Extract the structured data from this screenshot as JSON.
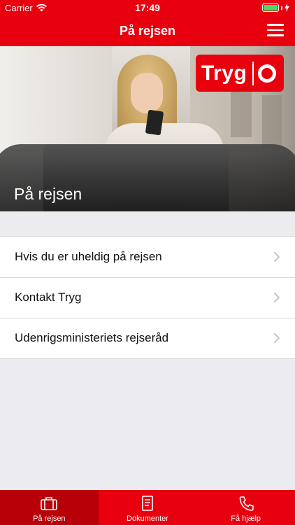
{
  "status_bar": {
    "carrier": "Carrier",
    "time": "17:49",
    "icons": [
      "wifi-icon",
      "battery-icon",
      "charging-icon"
    ],
    "battery_level": 1.0
  },
  "nav_bar": {
    "title": "På rejsen",
    "menu_icon": "hamburger-menu-icon"
  },
  "hero": {
    "caption": "På rejsen",
    "logo_text": "Tryg",
    "logo_icon": "lifebuoy-icon"
  },
  "menu_list": {
    "items": [
      {
        "label": "Hvis du er uheldig på rejsen",
        "icon": "chevron-right-icon"
      },
      {
        "label": "Kontakt Tryg",
        "icon": "chevron-right-icon"
      },
      {
        "label": "Udenrigsministeriets rejseråd",
        "icon": "chevron-right-icon"
      }
    ]
  },
  "tab_bar": {
    "tabs": [
      {
        "label": "På rejsen",
        "icon": "suitcase-icon",
        "active": true
      },
      {
        "label": "Dokumenter",
        "icon": "document-icon",
        "active": false
      },
      {
        "label": "Få hjælp",
        "icon": "phone-icon",
        "active": false
      }
    ]
  },
  "colors": {
    "brand_red": "#e8000f",
    "active_tab": "#b80009",
    "background": "#ebebf0",
    "battery_green": "#4cd964"
  }
}
